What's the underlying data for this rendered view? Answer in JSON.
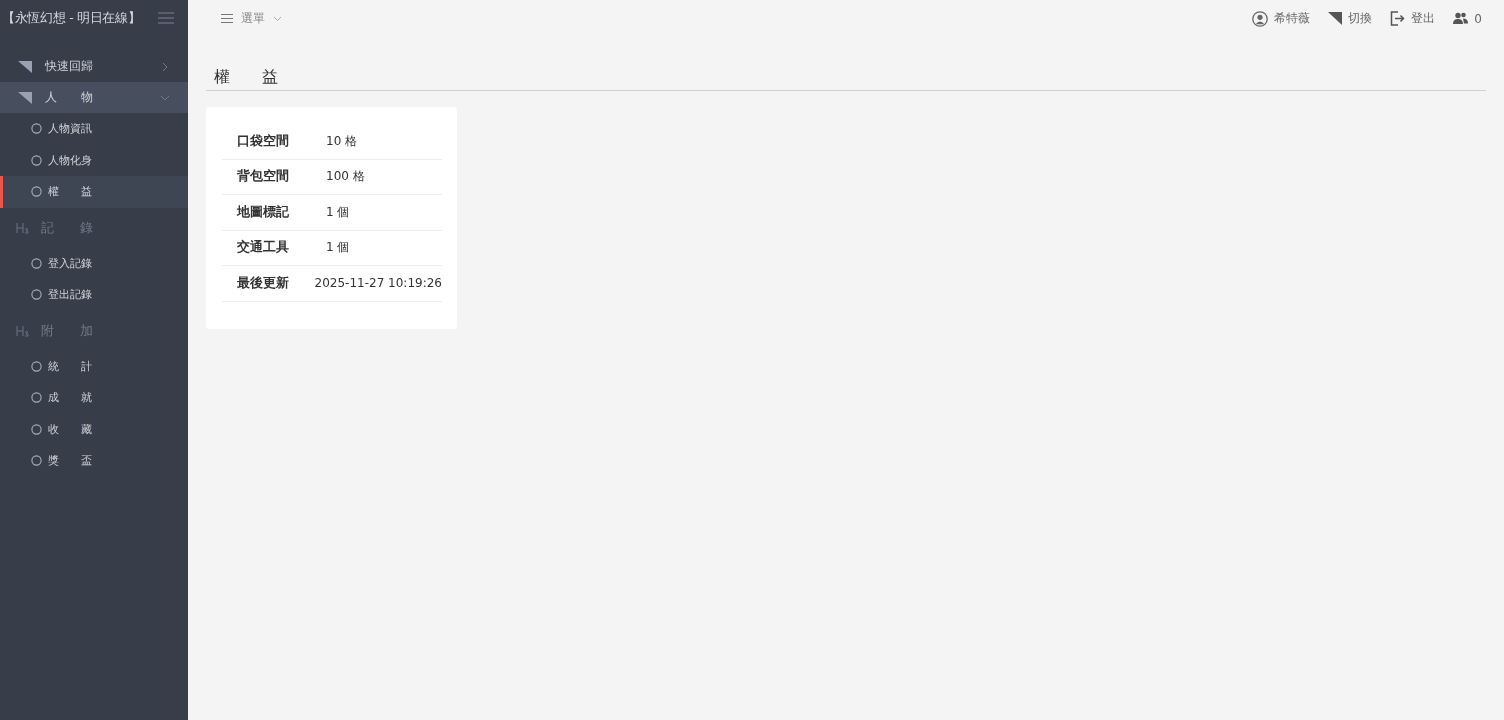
{
  "sidebar": {
    "title": "【永恆幻想 - 明日在線】",
    "items": [
      {
        "kind": "menu",
        "label": "快速回歸",
        "expanded": false
      },
      {
        "kind": "menu",
        "label": "人　　物",
        "expanded": true,
        "children": [
          {
            "label": "人物資訊",
            "selected": false
          },
          {
            "label": "人物化身",
            "selected": false
          },
          {
            "label": "權　　益",
            "selected": true
          }
        ]
      },
      {
        "kind": "header",
        "label": "記　　錄",
        "children": [
          {
            "label": "登入記錄",
            "selected": false
          },
          {
            "label": "登出記錄",
            "selected": false
          }
        ]
      },
      {
        "kind": "header",
        "label": "附　　加",
        "children": [
          {
            "label": "統　　計",
            "selected": false
          },
          {
            "label": "成　　就",
            "selected": false
          },
          {
            "label": "收　　藏",
            "selected": false
          },
          {
            "label": "獎　　盃",
            "selected": false
          }
        ]
      }
    ]
  },
  "topbar": {
    "menu_label": "選單",
    "user": "希特薇",
    "switch": "切換",
    "logout": "登出",
    "online_count": "0"
  },
  "page": {
    "title": "權　　益",
    "rows": [
      {
        "label": "口袋空間",
        "value": "10 格"
      },
      {
        "label": "背包空間",
        "value": "100 格"
      },
      {
        "label": "地圖標記",
        "value": "1 個"
      },
      {
        "label": "交通工具",
        "value": "1 個"
      },
      {
        "label": "最後更新",
        "value": "2025-11-27 10:19:26"
      }
    ]
  }
}
